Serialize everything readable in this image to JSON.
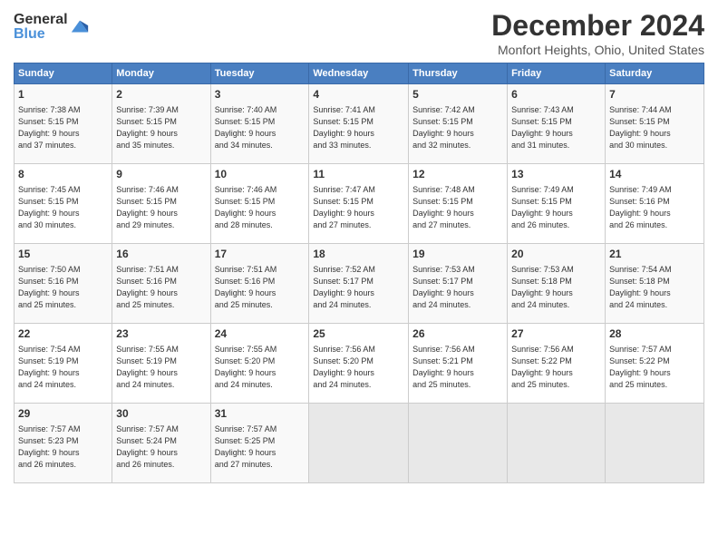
{
  "logo": {
    "general": "General",
    "blue": "Blue"
  },
  "title": "December 2024",
  "subtitle": "Monfort Heights, Ohio, United States",
  "weekdays": [
    "Sunday",
    "Monday",
    "Tuesday",
    "Wednesday",
    "Thursday",
    "Friday",
    "Saturday"
  ],
  "weeks": [
    [
      {
        "day": "1",
        "info": "Sunrise: 7:38 AM\nSunset: 5:15 PM\nDaylight: 9 hours\nand 37 minutes."
      },
      {
        "day": "2",
        "info": "Sunrise: 7:39 AM\nSunset: 5:15 PM\nDaylight: 9 hours\nand 35 minutes."
      },
      {
        "day": "3",
        "info": "Sunrise: 7:40 AM\nSunset: 5:15 PM\nDaylight: 9 hours\nand 34 minutes."
      },
      {
        "day": "4",
        "info": "Sunrise: 7:41 AM\nSunset: 5:15 PM\nDaylight: 9 hours\nand 33 minutes."
      },
      {
        "day": "5",
        "info": "Sunrise: 7:42 AM\nSunset: 5:15 PM\nDaylight: 9 hours\nand 32 minutes."
      },
      {
        "day": "6",
        "info": "Sunrise: 7:43 AM\nSunset: 5:15 PM\nDaylight: 9 hours\nand 31 minutes."
      },
      {
        "day": "7",
        "info": "Sunrise: 7:44 AM\nSunset: 5:15 PM\nDaylight: 9 hours\nand 30 minutes."
      }
    ],
    [
      {
        "day": "8",
        "info": "Sunrise: 7:45 AM\nSunset: 5:15 PM\nDaylight: 9 hours\nand 30 minutes."
      },
      {
        "day": "9",
        "info": "Sunrise: 7:46 AM\nSunset: 5:15 PM\nDaylight: 9 hours\nand 29 minutes."
      },
      {
        "day": "10",
        "info": "Sunrise: 7:46 AM\nSunset: 5:15 PM\nDaylight: 9 hours\nand 28 minutes."
      },
      {
        "day": "11",
        "info": "Sunrise: 7:47 AM\nSunset: 5:15 PM\nDaylight: 9 hours\nand 27 minutes."
      },
      {
        "day": "12",
        "info": "Sunrise: 7:48 AM\nSunset: 5:15 PM\nDaylight: 9 hours\nand 27 minutes."
      },
      {
        "day": "13",
        "info": "Sunrise: 7:49 AM\nSunset: 5:15 PM\nDaylight: 9 hours\nand 26 minutes."
      },
      {
        "day": "14",
        "info": "Sunrise: 7:49 AM\nSunset: 5:16 PM\nDaylight: 9 hours\nand 26 minutes."
      }
    ],
    [
      {
        "day": "15",
        "info": "Sunrise: 7:50 AM\nSunset: 5:16 PM\nDaylight: 9 hours\nand 25 minutes."
      },
      {
        "day": "16",
        "info": "Sunrise: 7:51 AM\nSunset: 5:16 PM\nDaylight: 9 hours\nand 25 minutes."
      },
      {
        "day": "17",
        "info": "Sunrise: 7:51 AM\nSunset: 5:16 PM\nDaylight: 9 hours\nand 25 minutes."
      },
      {
        "day": "18",
        "info": "Sunrise: 7:52 AM\nSunset: 5:17 PM\nDaylight: 9 hours\nand 24 minutes."
      },
      {
        "day": "19",
        "info": "Sunrise: 7:53 AM\nSunset: 5:17 PM\nDaylight: 9 hours\nand 24 minutes."
      },
      {
        "day": "20",
        "info": "Sunrise: 7:53 AM\nSunset: 5:18 PM\nDaylight: 9 hours\nand 24 minutes."
      },
      {
        "day": "21",
        "info": "Sunrise: 7:54 AM\nSunset: 5:18 PM\nDaylight: 9 hours\nand 24 minutes."
      }
    ],
    [
      {
        "day": "22",
        "info": "Sunrise: 7:54 AM\nSunset: 5:19 PM\nDaylight: 9 hours\nand 24 minutes."
      },
      {
        "day": "23",
        "info": "Sunrise: 7:55 AM\nSunset: 5:19 PM\nDaylight: 9 hours\nand 24 minutes."
      },
      {
        "day": "24",
        "info": "Sunrise: 7:55 AM\nSunset: 5:20 PM\nDaylight: 9 hours\nand 24 minutes."
      },
      {
        "day": "25",
        "info": "Sunrise: 7:56 AM\nSunset: 5:20 PM\nDaylight: 9 hours\nand 24 minutes."
      },
      {
        "day": "26",
        "info": "Sunrise: 7:56 AM\nSunset: 5:21 PM\nDaylight: 9 hours\nand 25 minutes."
      },
      {
        "day": "27",
        "info": "Sunrise: 7:56 AM\nSunset: 5:22 PM\nDaylight: 9 hours\nand 25 minutes."
      },
      {
        "day": "28",
        "info": "Sunrise: 7:57 AM\nSunset: 5:22 PM\nDaylight: 9 hours\nand 25 minutes."
      }
    ],
    [
      {
        "day": "29",
        "info": "Sunrise: 7:57 AM\nSunset: 5:23 PM\nDaylight: 9 hours\nand 26 minutes."
      },
      {
        "day": "30",
        "info": "Sunrise: 7:57 AM\nSunset: 5:24 PM\nDaylight: 9 hours\nand 26 minutes."
      },
      {
        "day": "31",
        "info": "Sunrise: 7:57 AM\nSunset: 5:25 PM\nDaylight: 9 hours\nand 27 minutes."
      },
      {
        "day": "",
        "info": ""
      },
      {
        "day": "",
        "info": ""
      },
      {
        "day": "",
        "info": ""
      },
      {
        "day": "",
        "info": ""
      }
    ]
  ]
}
